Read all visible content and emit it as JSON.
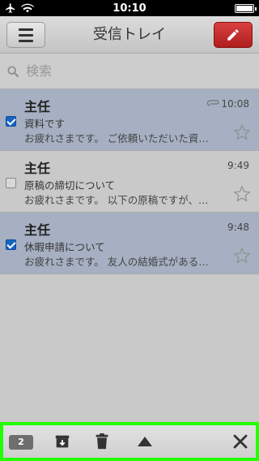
{
  "status": {
    "time": "10:10"
  },
  "header": {
    "title": "受信トレイ"
  },
  "search": {
    "placeholder": "検索"
  },
  "messages": [
    {
      "sender": "主任",
      "time": "10:08",
      "subject": "資料です",
      "snippet": "お疲れさまです。 ご依頼いただいた資料...",
      "selected": true,
      "attachment": true
    },
    {
      "sender": "主任",
      "time": "9:49",
      "subject": "原稿の締切について",
      "snippet": "お疲れさまです。 以下の原稿ですが、設...",
      "selected": false,
      "attachment": false
    },
    {
      "sender": "主任",
      "time": "9:48",
      "subject": "休暇申請について",
      "snippet": "お疲れさまです。 友人の結婚式があるた...",
      "selected": true,
      "attachment": false
    }
  ],
  "toolbar": {
    "selected_count": "2"
  },
  "colors": {
    "selected_row": "#a6b0c2",
    "compose": "#c62828",
    "checkbox": "#1565c0",
    "toolbar_border": "#22ff00"
  },
  "icons": [
    "airplane-icon",
    "wifi-icon",
    "battery-icon",
    "menu-icon",
    "pencil-icon",
    "search-icon",
    "paperclip-icon",
    "star-icon",
    "archive-icon",
    "trash-icon",
    "triangle-up-icon",
    "close-icon"
  ]
}
